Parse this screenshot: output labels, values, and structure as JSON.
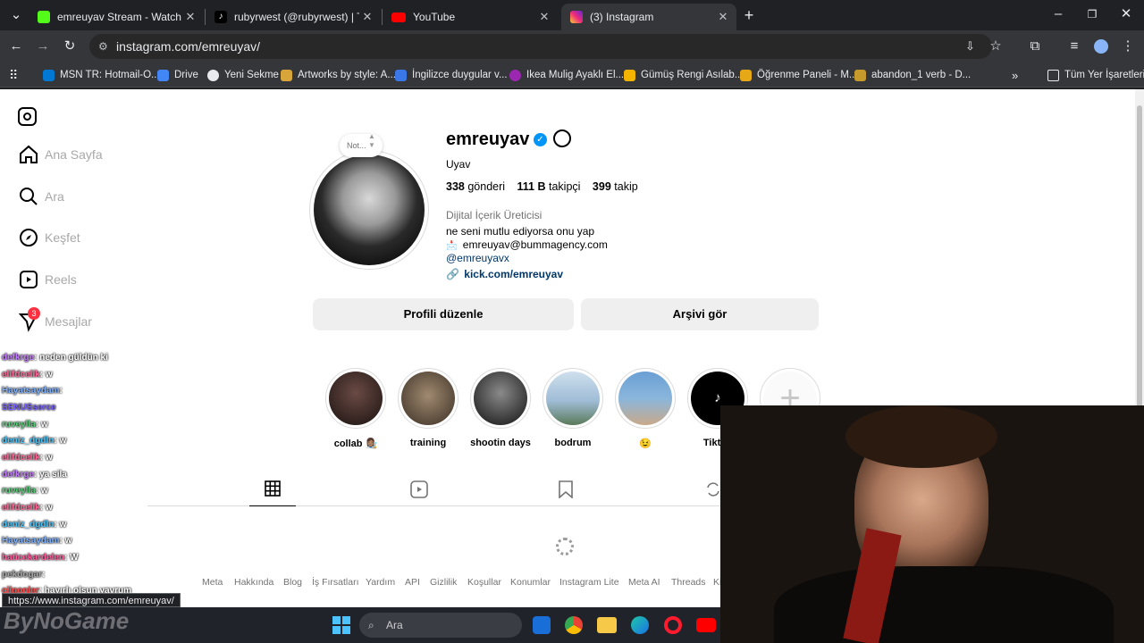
{
  "tabs": [
    {
      "title": "emreuyav Stream - Watch Live on Kick",
      "icon": "kick-icon",
      "color": "#53fc18"
    },
    {
      "title": "rubyrwest (@rubyrwest) | TikTok",
      "icon": "tiktok-icon",
      "color": "#000000"
    },
    {
      "title": "YouTube",
      "icon": "youtube-icon",
      "color": "#ff0000"
    },
    {
      "title": "(3) Instagram",
      "icon": "instagram-icon",
      "color": "#e1306c"
    }
  ],
  "address_bar": {
    "url": "instagram.com/emreuyav/"
  },
  "bookmarks": [
    {
      "label": "MSN TR: Hotmail-O...",
      "color": "#0078d4"
    },
    {
      "label": "Drive",
      "color": "#4285f4"
    },
    {
      "label": "Yeni Sekme",
      "color": "#e8eaed"
    },
    {
      "label": "Artworks by style: A...",
      "color": "#d7a53a"
    },
    {
      "label": "İngilizce duygular v...",
      "color": "#3b78e7"
    },
    {
      "label": "Ikea Mulig Ayaklı El...",
      "color": "#9c27b0"
    },
    {
      "label": "Gümüş Rengi Asılab...",
      "color": "#f4b400"
    },
    {
      "label": "Öğrenme Paneli - M...",
      "color": "#e6a817"
    },
    {
      "label": "abandon_1 verb - D...",
      "color": "#c69a2b"
    }
  ],
  "bookmarks_all": "Tüm Yer İşaretleri",
  "sidebar": {
    "items": [
      {
        "label": "Ana Sayfa",
        "icon": "home-icon"
      },
      {
        "label": "Ara",
        "icon": "search-icon"
      },
      {
        "label": "Keşfet",
        "icon": "compass-icon"
      },
      {
        "label": "Reels",
        "icon": "reels-icon"
      },
      {
        "label": "Mesajlar",
        "icon": "messages-icon",
        "badge": "3"
      }
    ]
  },
  "profile": {
    "note": "Not...",
    "username": "emreuyav",
    "display_name": "Uyav",
    "posts_count": "338",
    "posts_label": "gönderi",
    "followers_count": "111 B",
    "followers_label": "takipçi",
    "following_count": "399",
    "following_label": "takip",
    "category": "Dijital İçerik Üreticisi",
    "bio_line1": "ne seni mutlu ediyorsa onu yap",
    "email": "emreuyav@bummagency.com",
    "threads_handle": "@emreuyavx",
    "link": "kick.com/emreuyav",
    "edit_button": "Profili düzenle",
    "archive_button": "Arşivi gör"
  },
  "highlights": [
    {
      "label": "collab 👩🏽‍🎨",
      "color": "#3a2a28"
    },
    {
      "label": "training",
      "color": "#6b5a48"
    },
    {
      "label": "shootin days",
      "color": "#2a2a2a"
    },
    {
      "label": "bodrum",
      "color": "#7fa3c4"
    },
    {
      "label": "😉",
      "color": "#5b8ab8"
    },
    {
      "label": "Tiktok",
      "color": "#000000"
    }
  ],
  "footer": [
    "Meta",
    "Hakkında",
    "Blog",
    "İş Fırsatları",
    "Yardım",
    "API",
    "Gizlilik",
    "Koşullar",
    "Konumlar",
    "Instagram Lite",
    "Meta AI",
    "Threads",
    "Ki"
  ],
  "chat": [
    {
      "user": "defkrge",
      "msg": ": neden güldün ki",
      "color": "#c77dff"
    },
    {
      "user": "elifdcelik",
      "msg": ": w",
      "color": "#ff6b9a"
    },
    {
      "user": "Hayatsaydam",
      "msg": ":",
      "color": "#7fb3ff"
    },
    {
      "user": "SENUSserce",
      "msg": "",
      "color": "#7b61ff"
    },
    {
      "user": "ruveylla",
      "msg": ": w",
      "color": "#5ad17a"
    },
    {
      "user": "deniz_dgdln",
      "msg": ": w",
      "color": "#4fc3f7"
    },
    {
      "user": "elifdcelik",
      "msg": ": w",
      "color": "#ff6b9a"
    },
    {
      "user": "defkrge",
      "msg": ": ya sila",
      "color": "#c77dff"
    },
    {
      "user": "ruveylla",
      "msg": ": w",
      "color": "#5ad17a"
    },
    {
      "user": "elifdcelik",
      "msg": ": w",
      "color": "#ff6b9a"
    },
    {
      "user": "deniz_dgdln",
      "msg": ": w",
      "color": "#4fc3f7"
    },
    {
      "user": "Hayatsaydam",
      "msg": ": w",
      "color": "#7fb3ff"
    },
    {
      "user": "haticekardelen",
      "msg": ": W",
      "color": "#ff5d9e"
    },
    {
      "user": "pekdogar",
      "msg": ":",
      "color": "#aaaaaa"
    },
    {
      "user": "cilgonler",
      "msg": ": hayırlı olsun yavrum",
      "color": "#ff4d4d"
    }
  ],
  "status_url": "https://www.instagram.com/emreuyav/",
  "taskbar": {
    "search_placeholder": "Ara"
  },
  "watermark": "ByNoGame"
}
